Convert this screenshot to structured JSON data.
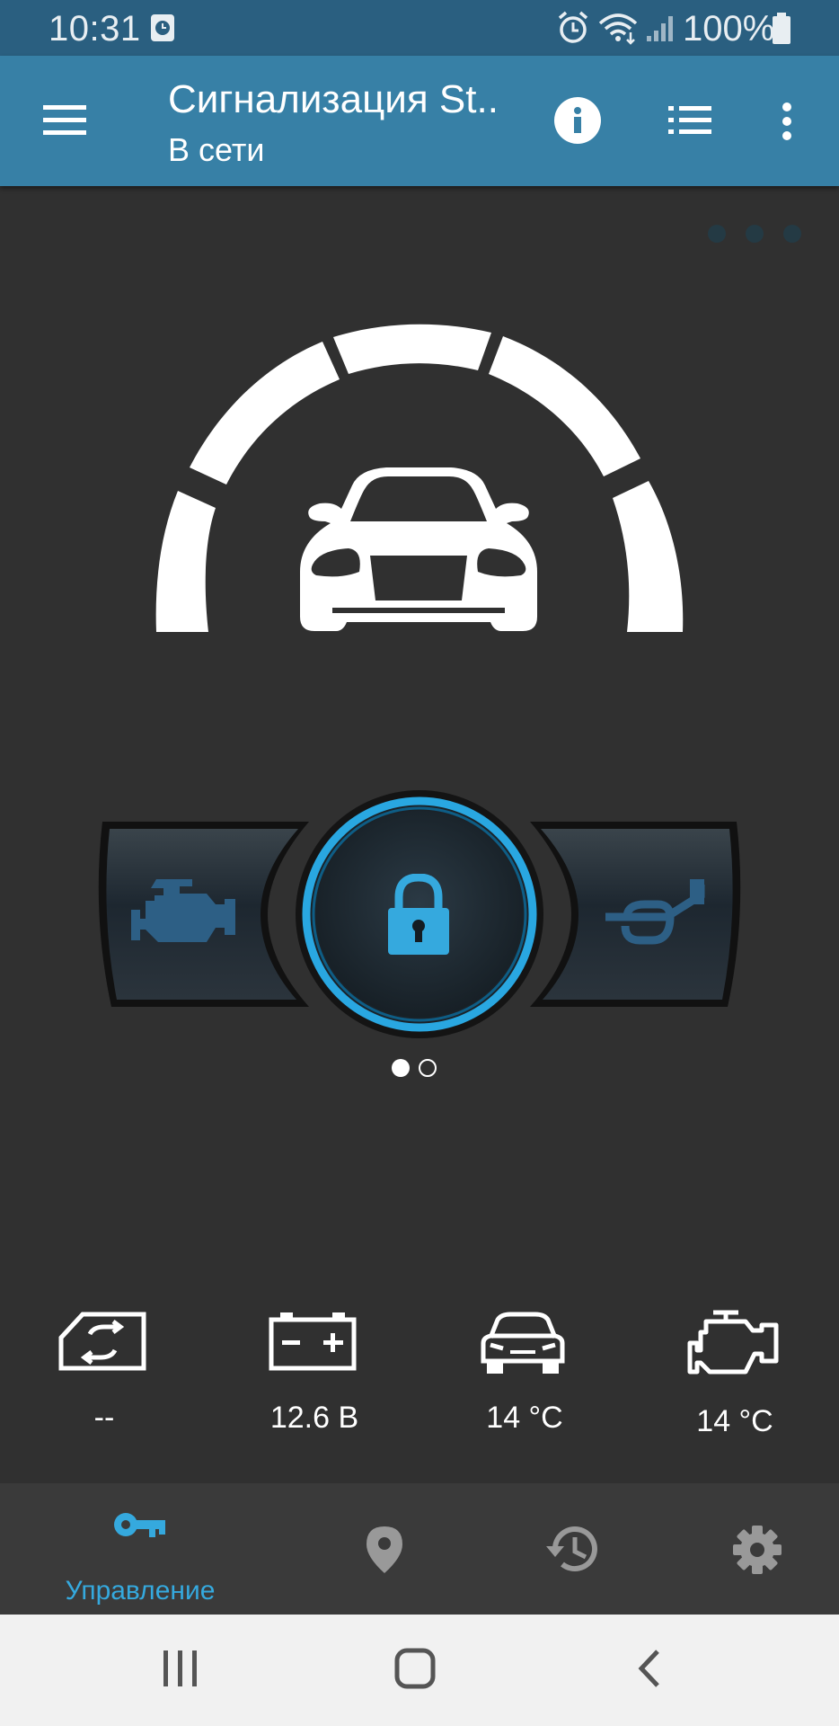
{
  "status_bar": {
    "time": "10:31",
    "battery": "100%"
  },
  "app_bar": {
    "title": "Сигнализация St..",
    "subtitle": "В сети"
  },
  "controls": {
    "left": "engine-icon",
    "center": "lock-icon",
    "right": "horn-icon",
    "pages": 2,
    "active_page": 1
  },
  "stats": [
    {
      "icon": "sim-card-icon",
      "value": "--"
    },
    {
      "icon": "battery-icon",
      "value": "12.6 В"
    },
    {
      "icon": "car-icon",
      "value": "14 °C"
    },
    {
      "icon": "engine-icon",
      "value": "14 °C"
    }
  ],
  "bottom_nav": {
    "active_label": "Управление",
    "items": [
      "key-icon",
      "location-pin-icon",
      "history-icon",
      "gear-icon"
    ]
  },
  "colors": {
    "status_bar": "#2a5f80",
    "app_bar": "#3780a6",
    "background": "#303030",
    "accent": "#35a9de",
    "inactive_button_icon": "#2d5f85"
  }
}
